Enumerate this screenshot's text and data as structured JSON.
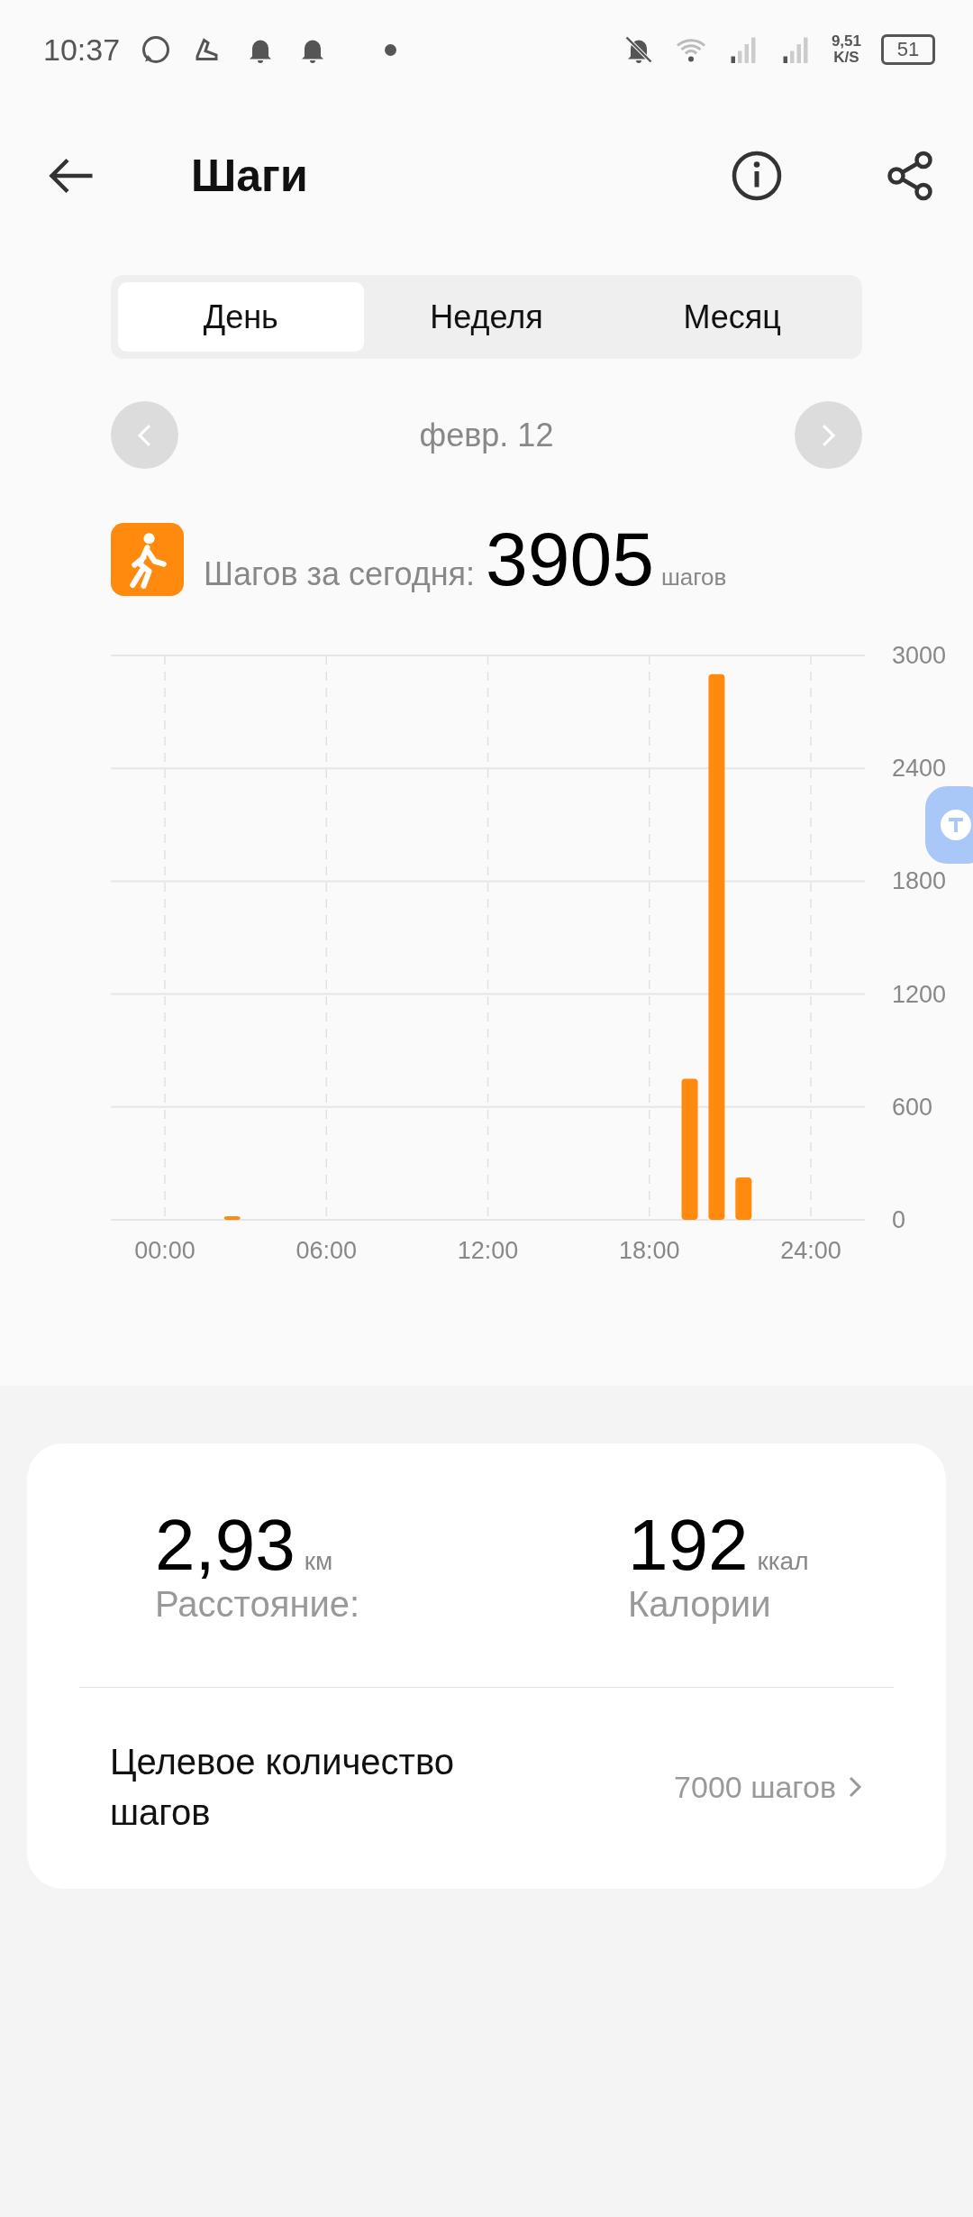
{
  "status_bar": {
    "time": "10:37",
    "net_speed": "9,51",
    "net_unit": "K/S",
    "battery": "51"
  },
  "header": {
    "title": "Шаги"
  },
  "tabs": [
    {
      "label": "День",
      "selected": true
    },
    {
      "label": "Неделя",
      "selected": false
    },
    {
      "label": "Месяц",
      "selected": false
    }
  ],
  "date": "февр. 12",
  "summary": {
    "label": "Шагов за сегодня:",
    "value": "3905",
    "unit": "шагов"
  },
  "chart_data": {
    "type": "bar",
    "x": [
      2.5,
      19.5,
      20.5,
      21.5
    ],
    "series": [
      {
        "color": "#ff8a0d",
        "values": [
          10,
          750,
          2900,
          225
        ]
      }
    ],
    "grid": true,
    "xlim": [
      0,
      24
    ],
    "ylim": [
      0,
      3000
    ],
    "xticks": [
      {
        "value": 0,
        "label": "00:00"
      },
      {
        "value": 6,
        "label": "06:00"
      },
      {
        "value": 12,
        "label": "12:00"
      },
      {
        "value": 18,
        "label": "18:00"
      },
      {
        "value": 24,
        "label": "24:00"
      }
    ],
    "yticks": [
      0,
      600,
      1200,
      1800,
      2400,
      3000
    ]
  },
  "stats": [
    {
      "value": "2,93",
      "unit": "км",
      "label": "Расстояние:"
    },
    {
      "value": "192",
      "unit": "ккал",
      "label": "Калории"
    }
  ],
  "goal": {
    "label": "Целевое количество шагов",
    "value": "7000 шагов"
  }
}
